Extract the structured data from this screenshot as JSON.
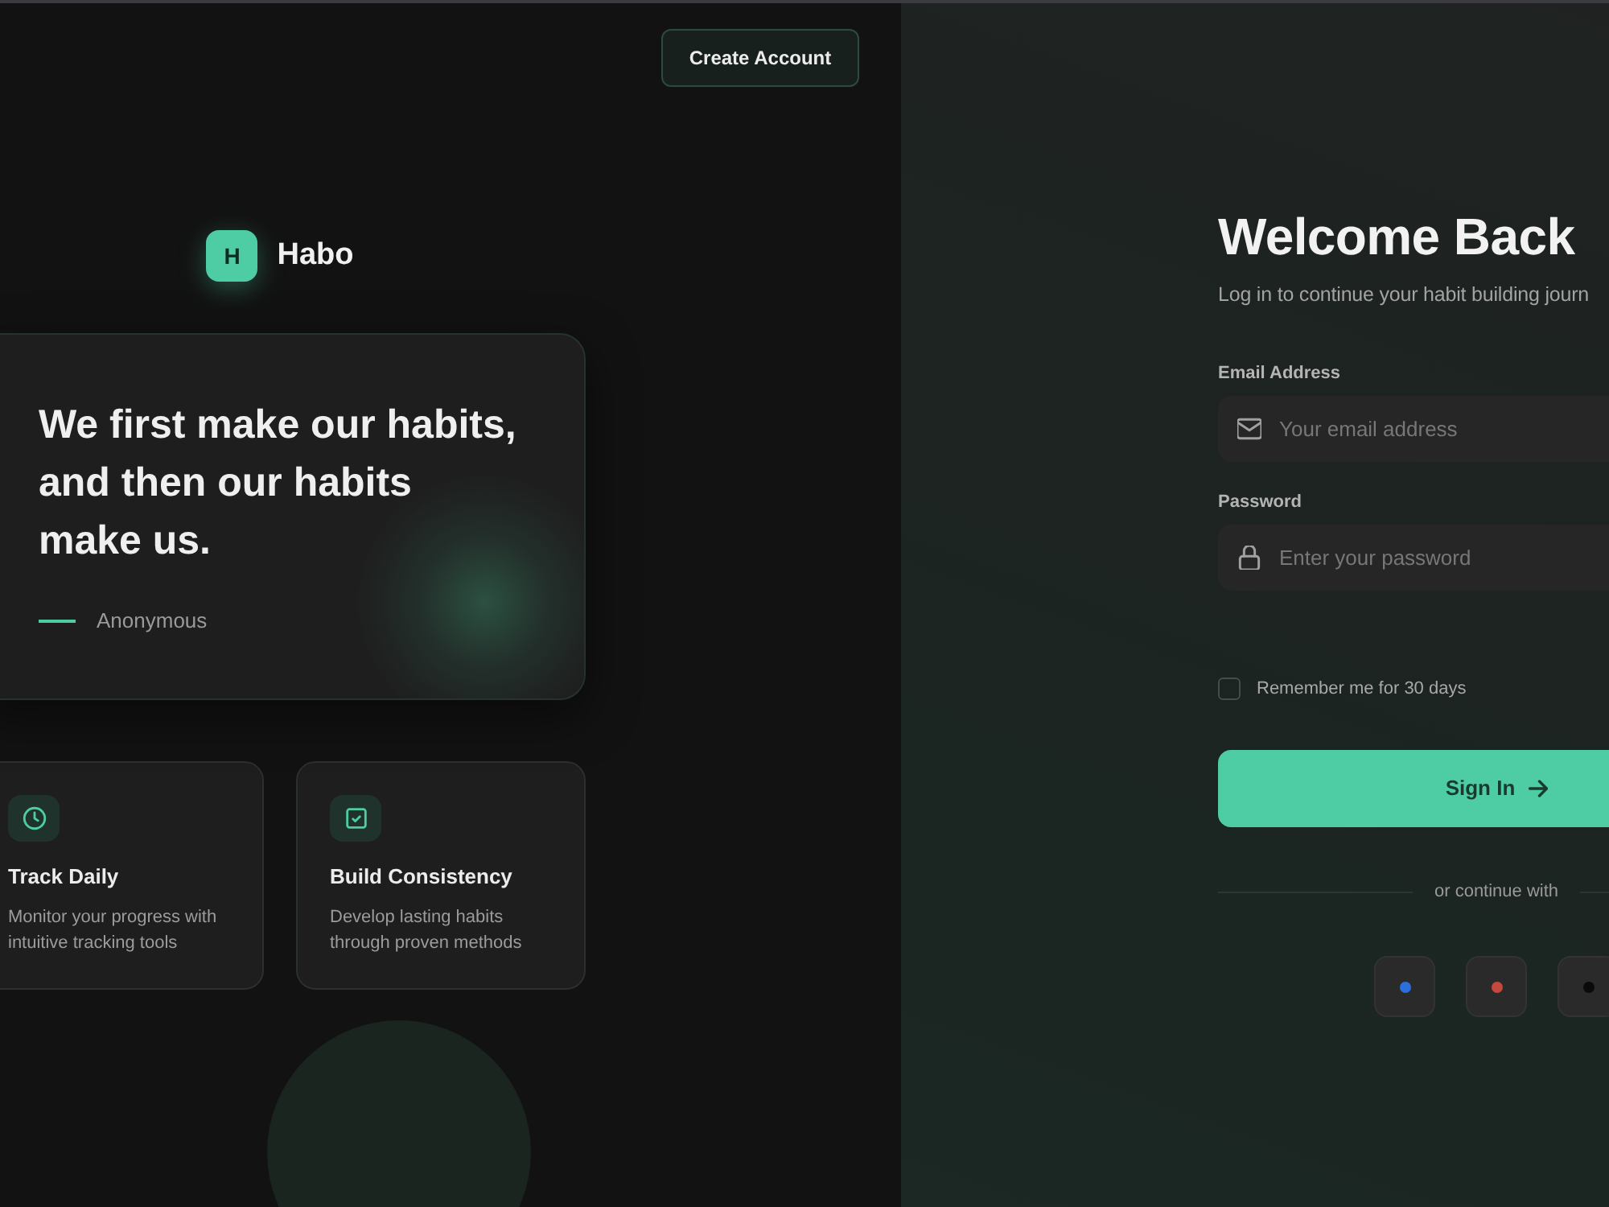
{
  "header": {
    "button": "Create Account"
  },
  "brand": {
    "initial": "H",
    "name": "Habo"
  },
  "quote": {
    "text": "We first make our habits, and then our habits make us.",
    "author": "Anonymous"
  },
  "features": [
    {
      "kind": "clock",
      "title": "Track Daily",
      "description": "Monitor your progress with intuitive tracking tools"
    },
    {
      "kind": "check",
      "title": "Build Consistency",
      "description": "Develop lasting habits through proven methods"
    }
  ],
  "login": {
    "title": "Welcome Back",
    "subtitle": "Log in to continue your habit building journ",
    "fields": [
      {
        "kind": "email",
        "label": "Email Address",
        "placeholder": "Your email address"
      },
      {
        "kind": "password",
        "label": "Password",
        "placeholder": "Enter your password"
      }
    ],
    "remember": {
      "label": "Remember me for 30 days",
      "checked": false
    },
    "submit": "Sign In",
    "divider": "or continue with",
    "social": [
      {
        "color": "#2a6fdb"
      },
      {
        "color": "#c4483b"
      },
      {
        "color": "#0a0a0a"
      }
    ]
  }
}
